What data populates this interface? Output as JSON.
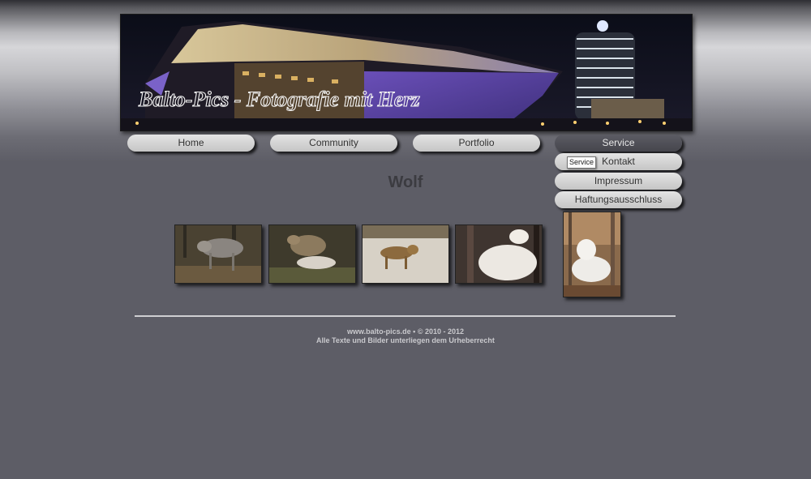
{
  "banner": {
    "text": "Balto-Pics - Fotografie mit Herz"
  },
  "nav": {
    "home": "Home",
    "community": "Community",
    "portfolio": "Portfolio",
    "service": "Service",
    "submenu": [
      "Kontakt",
      "Impressum",
      "Haftungsausschluss"
    ]
  },
  "tooltip": "Service",
  "page_title": "Wolf",
  "gallery": {
    "icons": [
      "wolf-photo-forest",
      "wolves-playing-photo",
      "wolf-in-snow-photo",
      "white-wolf-photo",
      "white-wolf-lying-photo"
    ]
  },
  "footer": {
    "line1": "www.balto-pics.de • © 2010 - 2012",
    "line2": "Alle Texte und Bilder unterliegen dem Urheberrecht"
  }
}
